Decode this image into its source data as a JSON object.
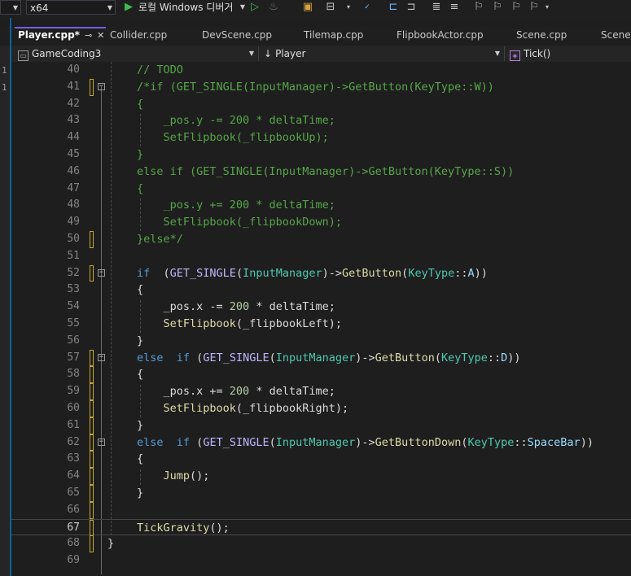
{
  "toolbar": {
    "platform": "x64",
    "run_label": "로컬 Windows 디버거",
    "icons": [
      "dropdown-icon",
      "play-icon",
      "play-outline-icon",
      "flame-icon",
      "debug-window-icon",
      "layout-icon",
      "spellcheck-icon",
      "comment-icon",
      "indent-icon",
      "bookmark-icon",
      "bookmark-prev-icon",
      "bookmark-next-icon",
      "more-icon"
    ]
  },
  "tabs": [
    {
      "label": "Player.cpp*",
      "active": true
    },
    {
      "label": "Collider.cpp",
      "active": false
    },
    {
      "label": "DevScene.cpp",
      "active": false
    },
    {
      "label": "Tilemap.cpp",
      "active": false
    },
    {
      "label": "FlipbookActor.cpp",
      "active": false
    },
    {
      "label": "Scene.cpp",
      "active": false
    },
    {
      "label": "SceneM",
      "active": false
    }
  ],
  "navbar": {
    "project": "GameCoding3",
    "scope": "Player",
    "member": "Tick()"
  },
  "left_strip": {
    "numbers": [
      "1",
      "1"
    ]
  },
  "colors": {
    "background": "#1e1e1e",
    "comment": "#57a64a",
    "keyword": "#569cd6",
    "macro": "#beb7ff",
    "type": "#4ec9b0",
    "function": "#dcdcaa",
    "number": "#b5cea8",
    "active_tab_accent": "#7160e8",
    "change_marker": "#c6a829"
  },
  "editor": {
    "lines": [
      {
        "num": "40",
        "text": "// TODO"
      },
      {
        "num": "41",
        "text": "/*if (GET_SINGLE(InputManager)->GetButton(KeyType::W))"
      },
      {
        "num": "42",
        "text": "{"
      },
      {
        "num": "43",
        "text": "    _pos.y -= 200 * deltaTime;"
      },
      {
        "num": "44",
        "text": "    SetFlipbook(_flipbookUp);"
      },
      {
        "num": "45",
        "text": "}"
      },
      {
        "num": "46",
        "text": "else if (GET_SINGLE(InputManager)->GetButton(KeyType::S))"
      },
      {
        "num": "47",
        "text": "{"
      },
      {
        "num": "48",
        "text": "    _pos.y += 200 * deltaTime;"
      },
      {
        "num": "49",
        "text": "    SetFlipbook(_flipbookDown);"
      },
      {
        "num": "50",
        "text": "}else*/"
      },
      {
        "num": "51",
        "text": ""
      },
      {
        "num": "52",
        "text": "if  (GET_SINGLE(InputManager)->GetButton(KeyType::A))"
      },
      {
        "num": "53",
        "text": "{"
      },
      {
        "num": "54",
        "text": "    _pos.x -= 200 * deltaTime;"
      },
      {
        "num": "55",
        "text": "    SetFlipbook(_flipbookLeft);"
      },
      {
        "num": "56",
        "text": "}"
      },
      {
        "num": "57",
        "text": "else  if (GET_SINGLE(InputManager)->GetButton(KeyType::D))"
      },
      {
        "num": "58",
        "text": "{"
      },
      {
        "num": "59",
        "text": "    _pos.x += 200 * deltaTime;"
      },
      {
        "num": "60",
        "text": "    SetFlipbook(_flipbookRight);"
      },
      {
        "num": "61",
        "text": "}"
      },
      {
        "num": "62",
        "text": "else  if (GET_SINGLE(InputManager)->GetButtonDown(KeyType::SpaceBar))"
      },
      {
        "num": "63",
        "text": "{"
      },
      {
        "num": "64",
        "text": "    Jump();"
      },
      {
        "num": "65",
        "text": "}"
      },
      {
        "num": "66",
        "text": ""
      },
      {
        "num": "67",
        "text": "TickGravity();"
      },
      {
        "num": "68",
        "text": "}"
      },
      {
        "num": "69",
        "text": ""
      }
    ],
    "current_line": "67"
  }
}
